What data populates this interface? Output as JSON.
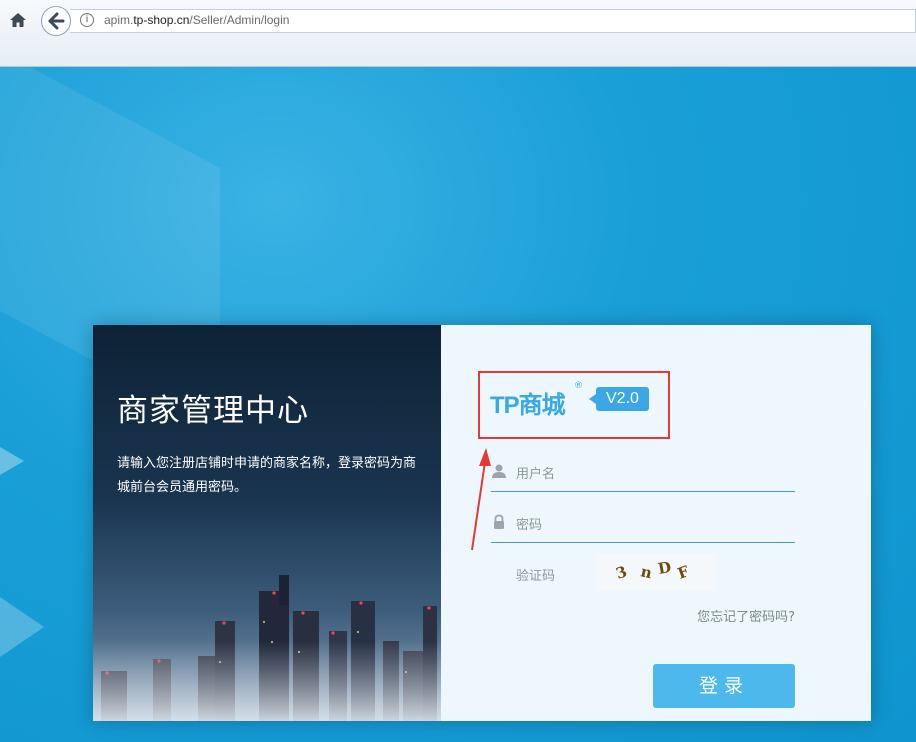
{
  "browser": {
    "url_prefix": "apim.",
    "url_domain": "tp-shop.cn",
    "url_path": "/Seller/Admin/login",
    "info_glyph": "i",
    "icons": [
      "home-icon",
      "back-icon",
      "info-icon"
    ]
  },
  "left_panel": {
    "title": "商家管理中心",
    "description": "请输入您注册店铺时申请的商家名称，登录密码为商城前台会员通用密码。"
  },
  "logo": {
    "brand": "TP商城",
    "registered": "®",
    "version": "V2.0"
  },
  "form": {
    "username_placeholder": "用户名",
    "password_placeholder": "密码",
    "captcha_label": "验证码",
    "captcha_text": "3nDF",
    "forgot_link": "您忘记了密码吗?",
    "login_button": "登录"
  },
  "colors": {
    "accent": "#3aa7e6",
    "button": "#4db8ec",
    "highlight_box": "#e53935",
    "annotation_arrow": "#e53935"
  }
}
